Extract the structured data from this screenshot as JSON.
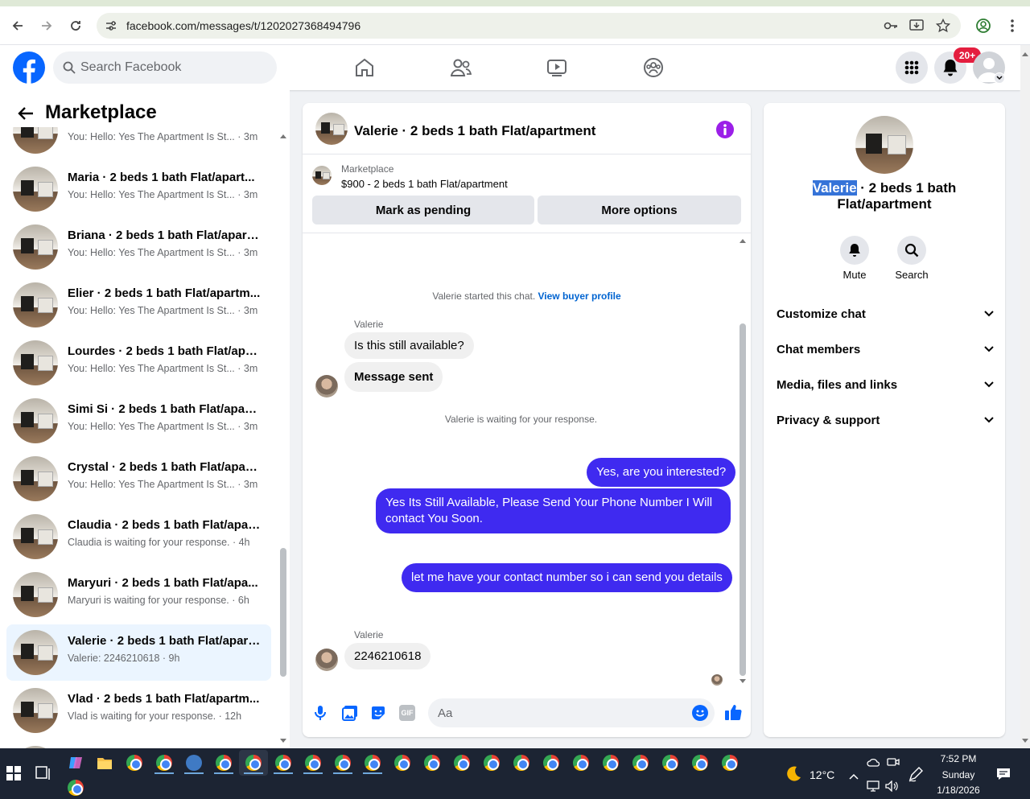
{
  "browser": {
    "url": "facebook.com/messages/t/1202027368494796"
  },
  "fb_header": {
    "search_placeholder": "Search Facebook",
    "notifications_badge": "20+"
  },
  "left": {
    "title": "Marketplace",
    "first_preview": "You: Hello: Yes The Apartment Is St... · 3m",
    "conversations": [
      {
        "name": "Maria · 2 beds 1 bath Flat/apart...",
        "preview": "You: Hello: Yes The Apartment Is St... · 3m"
      },
      {
        "name": "Briana · 2 beds 1 bath Flat/apart...",
        "preview": "You: Hello: Yes The Apartment Is St... · 3m"
      },
      {
        "name": "Elier · 2 beds 1 bath Flat/apartm...",
        "preview": "You: Hello: Yes The Apartment Is St... · 3m"
      },
      {
        "name": "Lourdes · 2 beds 1 bath Flat/apa...",
        "preview": "You: Hello: Yes The Apartment Is St... · 3m"
      },
      {
        "name": "Simi Si · 2 beds 1 bath Flat/apart...",
        "preview": "You: Hello: Yes The Apartment Is St... · 3m"
      },
      {
        "name": "Crystal · 2 beds 1 bath Flat/apart...",
        "preview": "You: Hello: Yes The Apartment Is St... · 3m"
      },
      {
        "name": "Claudia · 2 beds 1 bath Flat/apar...",
        "preview": "Claudia is waiting for your response. · 4h"
      },
      {
        "name": "Maryuri · 2 beds 1 bath Flat/apa...",
        "preview": "Maryuri is waiting for your response. · 6h"
      },
      {
        "name": "Valerie · 2 beds 1 bath Flat/apart...",
        "preview": "Valerie: 2246210618 · 9h"
      },
      {
        "name": "Vlad · 2 beds 1 bath Flat/apartm...",
        "preview": "Vlad is waiting for your response. · 12h"
      }
    ]
  },
  "chat": {
    "title": "Valerie · 2 beds 1 bath Flat/apartment",
    "listing_label": "Marketplace",
    "listing_price": "$900 - 2 beds 1 bath Flat/apartment",
    "mark_pending": "Mark as pending",
    "more_options": "More options",
    "started_text": "Valerie started this chat.",
    "view_profile": "View buyer profile",
    "sender1": "Valerie",
    "msg_in1": "Is this still available?",
    "msg_in2": "Message sent",
    "waiting": "Valerie is waiting for your response.",
    "msg_out1": "Yes, are you interested?",
    "msg_out2": "Yes Its Still Available, Please Send Your Phone Number I Will contact You Soon.",
    "msg_out3": "let me have your contact number so i can send you details",
    "sender2": "Valerie",
    "msg_in3": "2246210618",
    "composer_placeholder": "Aa",
    "gif_label": "GIF"
  },
  "right": {
    "name_highlight": "Valerie",
    "name_rest": " · 2 beds 1 bath Flat/apartment",
    "mute": "Mute",
    "search": "Search",
    "sections": [
      "Customize chat",
      "Chat members",
      "Media, files and links",
      "Privacy & support"
    ]
  },
  "taskbar": {
    "temp": "12°C",
    "time": "7:52 PM",
    "day": "Sunday",
    "date": "1/18/2026"
  },
  "colors": {
    "fb_blue": "#0866ff",
    "bubble_out": "#3f2af0",
    "info_purple": "#9b1fe8",
    "badge_red": "#e41e3f"
  }
}
